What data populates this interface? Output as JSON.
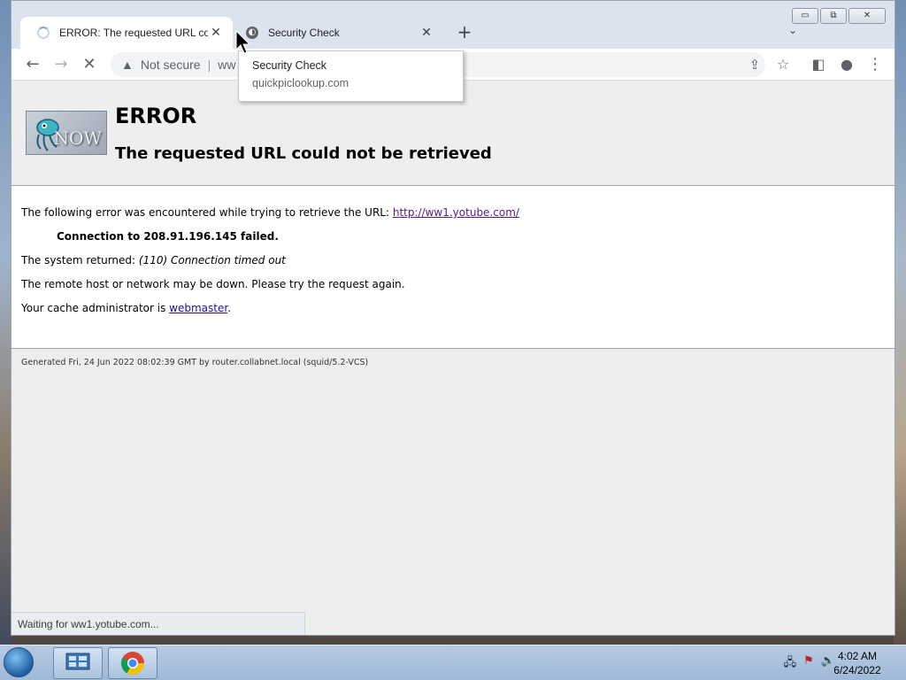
{
  "tabs": [
    {
      "title": "ERROR: The requested URL could not be retrieved",
      "active": true
    },
    {
      "title": "Security Check",
      "active": false
    }
  ],
  "new_tab_label": "+",
  "address_bar": {
    "security_label": "Not secure",
    "url_visible": "ww"
  },
  "tooltip": {
    "title": "Security Check",
    "url": "quickpiclookup.com"
  },
  "page": {
    "logo_text": "NOW",
    "heading": "ERROR",
    "subheading": "The requested URL could not be retrieved",
    "line1_prefix": "The following error was encountered while trying to retrieve the URL: ",
    "line1_link": "http://ww1.yotube.com/",
    "connection": "Connection to 208.91.196.145 failed.",
    "system_prefix": "The system returned: ",
    "system_error": "(110) Connection timed out",
    "remote_host": "The remote host or network may be down. Please try the request again.",
    "cache_prefix": "Your cache administrator is ",
    "cache_link": "webmaster",
    "cache_suffix": ".",
    "generated": "Generated Fri, 24 Jun 2022 08:02:39 GMT by router.collabnet.local (squid/5.2-VCS)"
  },
  "status_bar": "Waiting for ww1.yotube.com...",
  "clock": {
    "time": "4:02 AM",
    "date": "6/24/2022"
  }
}
